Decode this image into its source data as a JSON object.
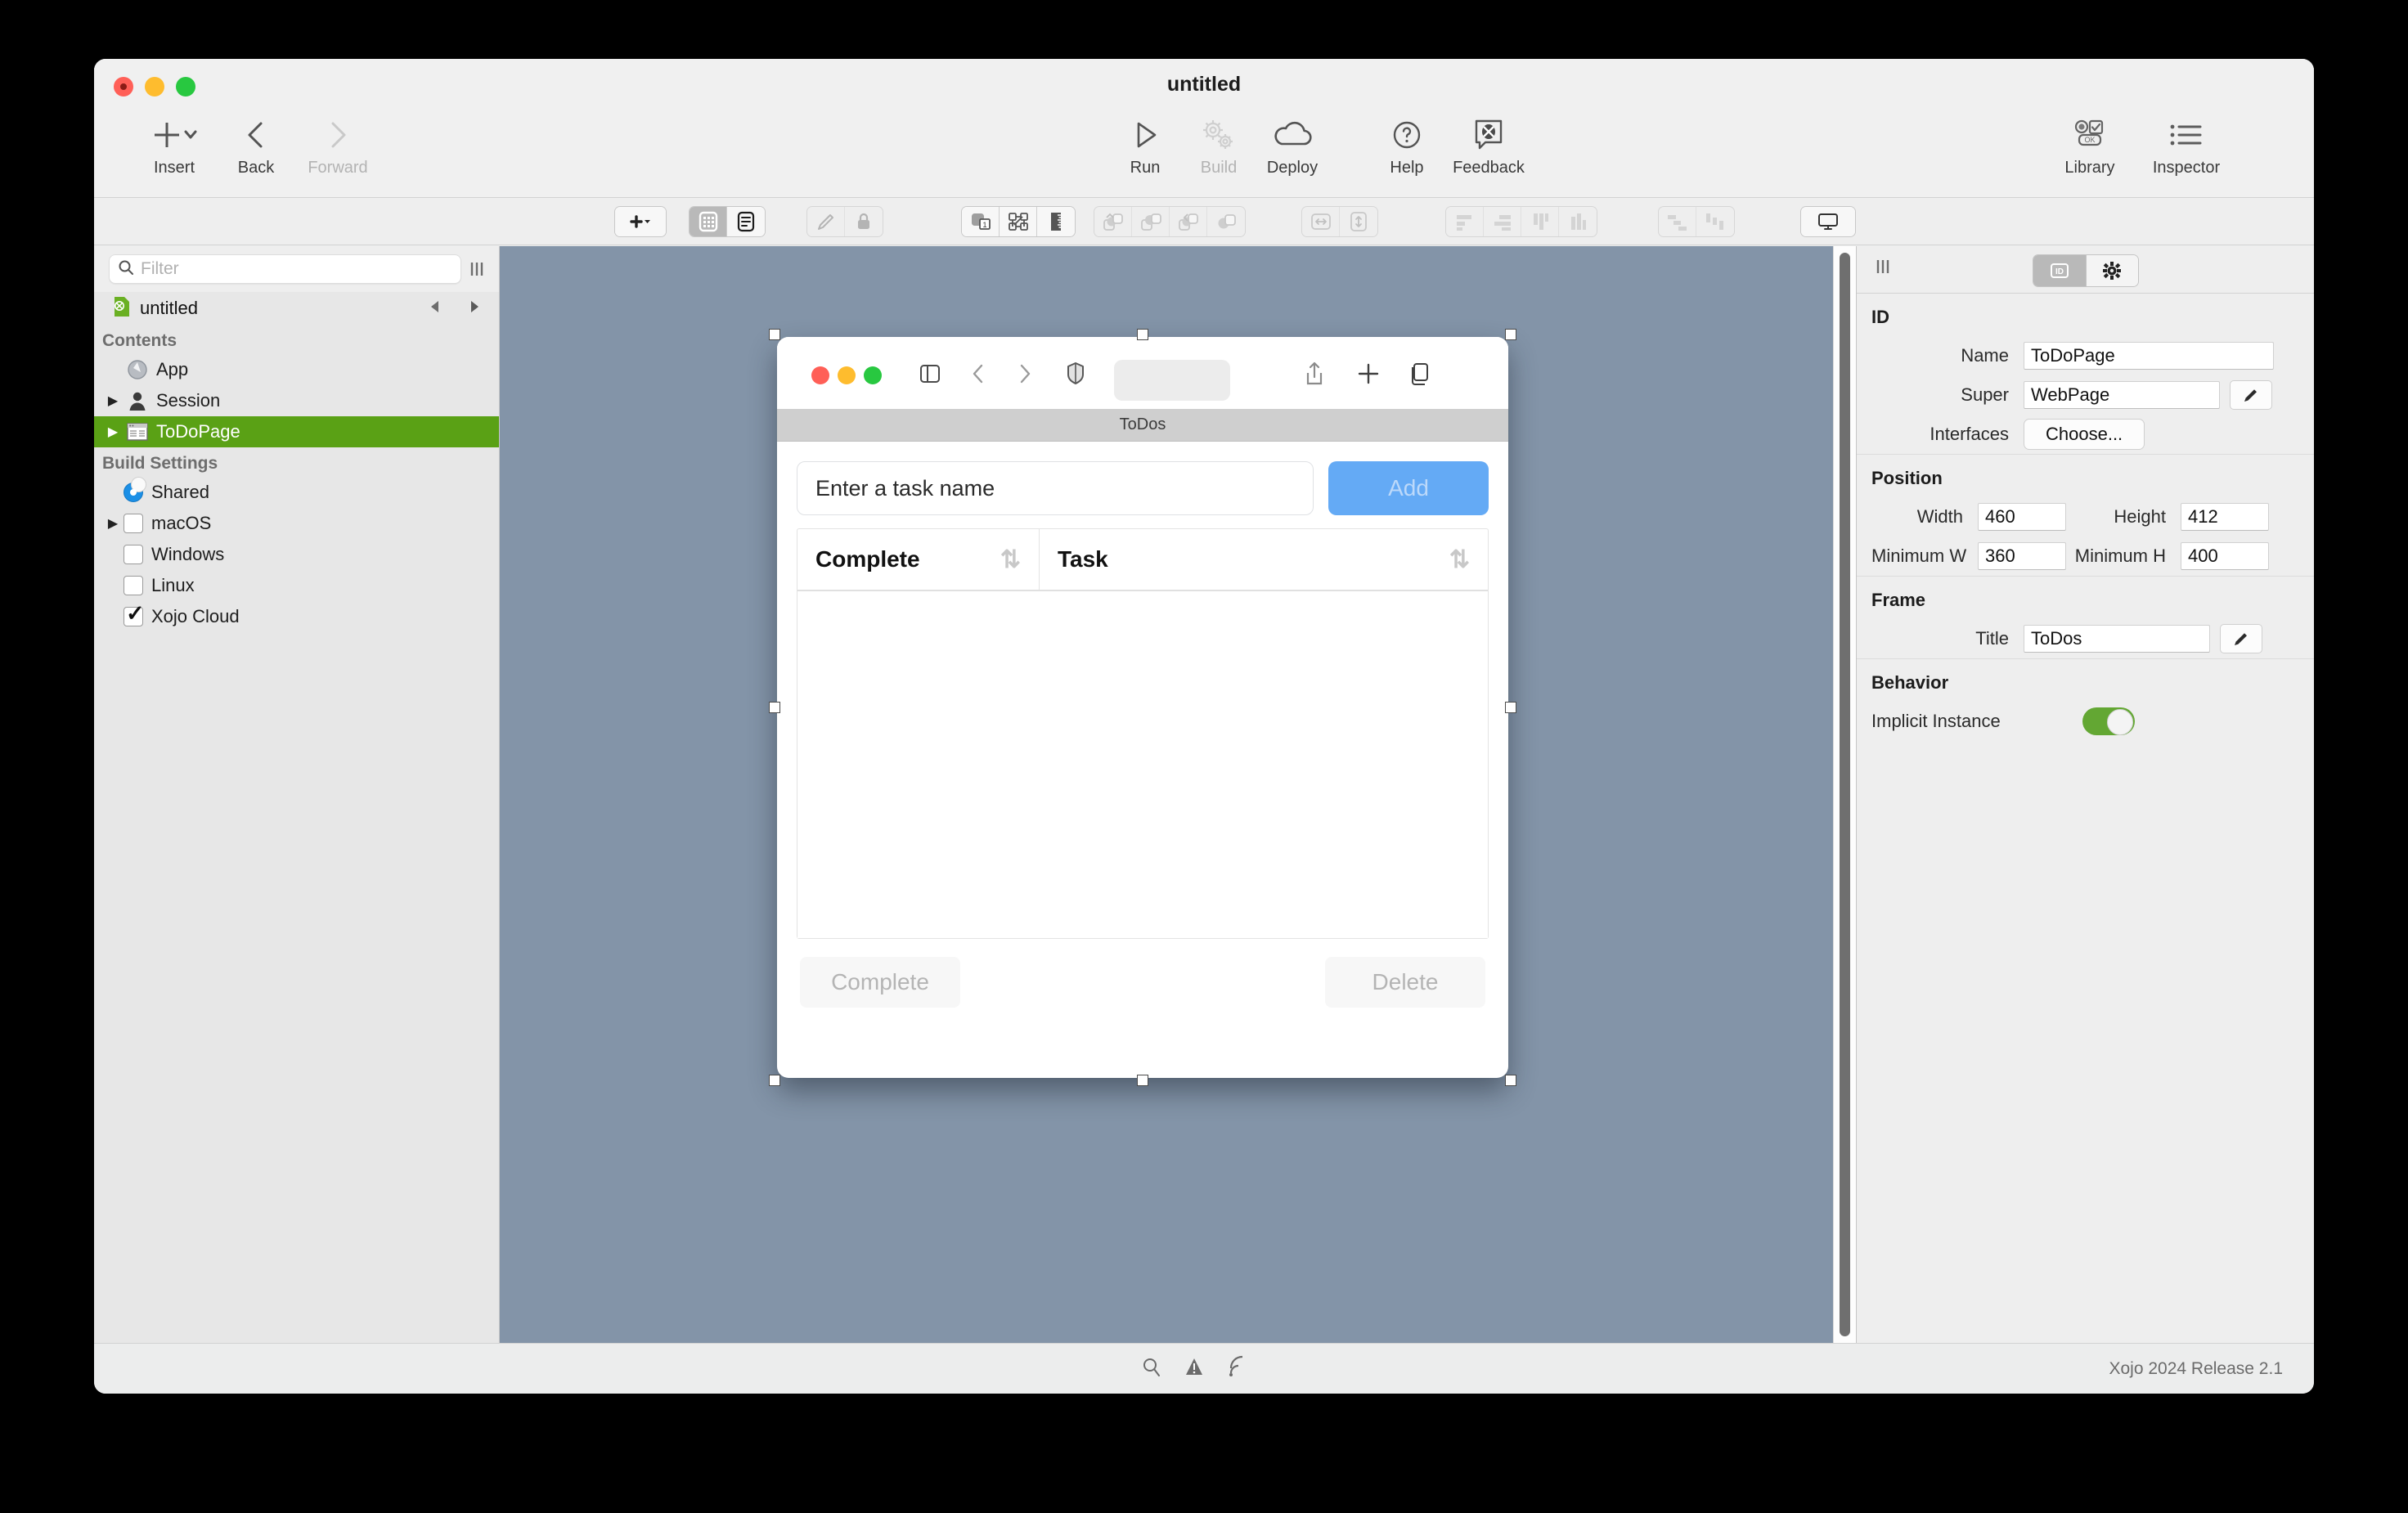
{
  "window": {
    "title": "untitled",
    "traffic_lights": [
      "close",
      "minimize",
      "zoom"
    ]
  },
  "toolbar": {
    "items": [
      {
        "label": "Insert",
        "icon": "plus-dropdown-icon",
        "disabled": false
      },
      {
        "label": "Back",
        "icon": "chevron-left-icon",
        "disabled": false
      },
      {
        "label": "Forward",
        "icon": "chevron-right-icon",
        "disabled": true
      },
      {
        "label": "Run",
        "icon": "play-icon",
        "disabled": false
      },
      {
        "label": "Build",
        "icon": "gears-icon",
        "disabled": true
      },
      {
        "label": "Deploy",
        "icon": "cloud-icon",
        "disabled": false
      },
      {
        "label": "Help",
        "icon": "question-circle-icon",
        "disabled": false
      },
      {
        "label": "Feedback",
        "icon": "feedback-balloon-icon",
        "disabled": false
      },
      {
        "label": "Library",
        "icon": "library-controls-icon",
        "disabled": false
      },
      {
        "label": "Inspector",
        "icon": "list-bullets-icon",
        "disabled": false
      }
    ]
  },
  "layout_toolbar": {
    "groups": [
      {
        "name": "insert-control",
        "cells": [
          {
            "icon": "plus-small-dropdown-icon",
            "active": false
          }
        ]
      },
      {
        "name": "view-mode",
        "cells": [
          {
            "icon": "grid-layout-icon",
            "active": true
          },
          {
            "icon": "code-list-icon",
            "active": false
          }
        ]
      },
      {
        "name": "edit-lock",
        "cells": [
          {
            "icon": "pencil-icon",
            "active": false,
            "ghost": true
          },
          {
            "icon": "lock-icon",
            "active": false,
            "ghost": true
          }
        ]
      },
      {
        "name": "layers",
        "cells": [
          {
            "icon": "layer-index-icon",
            "active": false
          },
          {
            "icon": "shuffle-layers-icon",
            "active": false
          },
          {
            "icon": "ruler-icon",
            "active": false
          }
        ]
      },
      {
        "name": "order",
        "cells": [
          {
            "icon": "bring-to-front-icon",
            "active": false,
            "ghost": true
          },
          {
            "icon": "bring-forward-icon",
            "active": false,
            "ghost": true
          },
          {
            "icon": "send-backward-icon",
            "active": false,
            "ghost": true
          },
          {
            "icon": "send-to-back-icon",
            "active": false,
            "ghost": true
          }
        ]
      },
      {
        "name": "size",
        "cells": [
          {
            "icon": "match-width-icon",
            "active": false,
            "ghost": true
          },
          {
            "icon": "match-height-icon",
            "active": false,
            "ghost": true
          }
        ]
      },
      {
        "name": "align",
        "cells": [
          {
            "icon": "align-left-icon",
            "active": false,
            "ghost": true
          },
          {
            "icon": "align-right-icon",
            "active": false,
            "ghost": true
          },
          {
            "icon": "align-top-icon",
            "active": false,
            "ghost": true
          },
          {
            "icon": "align-bottom-icon",
            "active": false,
            "ghost": true
          }
        ]
      },
      {
        "name": "distribute",
        "cells": [
          {
            "icon": "distribute-horizontal-icon",
            "active": false,
            "ghost": true
          },
          {
            "icon": "distribute-vertical-icon",
            "active": false,
            "ghost": true
          }
        ]
      },
      {
        "name": "preview-device",
        "cells": [
          {
            "icon": "desktop-monitor-icon",
            "active": false
          }
        ]
      }
    ]
  },
  "navigator": {
    "filter_placeholder": "Filter",
    "filter_value": "",
    "project_name": "untitled",
    "groups": [
      {
        "header": "Contents",
        "items": [
          {
            "label": "App",
            "icon": "app-globe-icon",
            "disclosure": false,
            "selected": false
          },
          {
            "label": "Session",
            "icon": "session-user-icon",
            "disclosure": true,
            "selected": false
          },
          {
            "label": "ToDoPage",
            "icon": "webpage-icon",
            "disclosure": true,
            "selected": true
          }
        ]
      },
      {
        "header": "Build Settings",
        "items": [
          {
            "label": "Shared",
            "control": "radio",
            "checked": true,
            "disclosure": false,
            "selected": false
          },
          {
            "label": "macOS",
            "control": "checkbox",
            "checked": false,
            "disclosure": true,
            "selected": false
          },
          {
            "label": "Windows",
            "control": "checkbox",
            "checked": false,
            "disclosure": false,
            "selected": false
          },
          {
            "label": "Linux",
            "control": "checkbox",
            "checked": false,
            "disclosure": false,
            "selected": false
          },
          {
            "label": "Xojo Cloud",
            "control": "checkbox",
            "checked": true,
            "disclosure": false,
            "selected": false
          }
        ]
      }
    ]
  },
  "canvas": {
    "background_color": "#8394a8",
    "preview": {
      "window_title": "ToDos",
      "browser_dots": [
        "close",
        "minimize",
        "zoom"
      ],
      "browser_icons": [
        "sidebar-icon",
        "back-chevron-icon",
        "forward-chevron-icon",
        "shield-icon",
        "share-icon",
        "new-tab-plus-icon",
        "tab-overview-icon"
      ],
      "task_input_placeholder": "Enter a task name",
      "task_input_value": "",
      "add_button": "Add",
      "table": {
        "columns": [
          {
            "label": "Complete",
            "sort_icon": "sort-updown-icon"
          },
          {
            "label": "Task",
            "sort_icon": "sort-updown-icon"
          }
        ],
        "rows": []
      },
      "complete_button": "Complete",
      "delete_button": "Delete"
    }
  },
  "inspector": {
    "tabs": [
      {
        "name": "id-tab",
        "icon": "id-badge-icon",
        "active": true
      },
      {
        "name": "settings-tab",
        "icon": "gear-icon",
        "active": false
      }
    ],
    "sections": [
      {
        "title": "ID",
        "fields": [
          {
            "label": "Name",
            "value": "ToDoPage",
            "type": "text"
          },
          {
            "label": "Super",
            "value": "WebPage",
            "type": "text-with-pencil"
          },
          {
            "label": "Interfaces",
            "value": "Choose...",
            "type": "button"
          }
        ]
      },
      {
        "title": "Position",
        "fields": [
          {
            "label": "Width",
            "value": "460",
            "type": "number"
          },
          {
            "label": "Height",
            "value": "412",
            "type": "number"
          },
          {
            "label": "Minimum W",
            "value": "360",
            "type": "number"
          },
          {
            "label": "Minimum H",
            "value": "400",
            "type": "number"
          }
        ]
      },
      {
        "title": "Frame",
        "fields": [
          {
            "label": "Title",
            "value": "ToDos",
            "type": "text-with-pencil"
          }
        ]
      },
      {
        "title": "Behavior",
        "fields": [
          {
            "label": "Implicit Instance",
            "value": "on",
            "type": "toggle"
          }
        ]
      }
    ]
  },
  "statusbar": {
    "icons": [
      "search-icon",
      "warning-triangle-icon",
      "broadcast-icon"
    ],
    "version": "Xojo 2024 Release 2.1"
  }
}
